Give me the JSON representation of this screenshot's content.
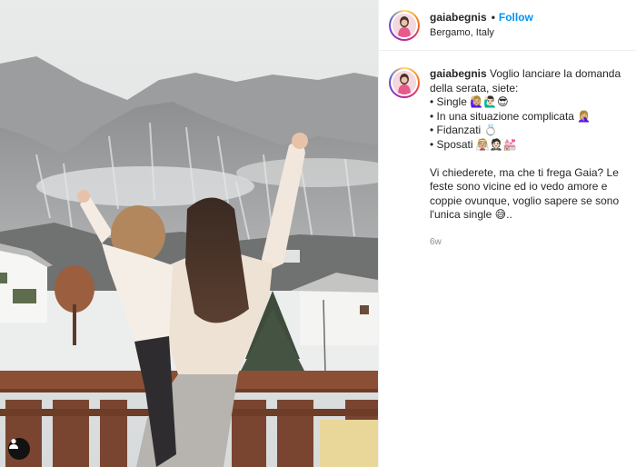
{
  "post": {
    "username": "gaiabegnis",
    "separator": "•",
    "follow_label": "Follow",
    "location": "Bergamo, Italy"
  },
  "caption": {
    "intro": "Voglio lanciare la domanda della serata, siete:",
    "options": [
      "• Single 🙋🏼‍♀️🙋🏻‍♂️😎",
      "• In una situazione complicata 🤦🏼‍♀️",
      "• Fidanzati 💍",
      "• Sposati 👰🏼🤵🏻💒"
    ],
    "body": "Vi chiederete, ma che ti frega Gaia? Le feste sono vicine ed io vedo amore e coppie ovunque, voglio sapere se sono l'unica single 😅..",
    "time": "6w"
  },
  "icons": {
    "user_tag": "user-tag-icon"
  }
}
